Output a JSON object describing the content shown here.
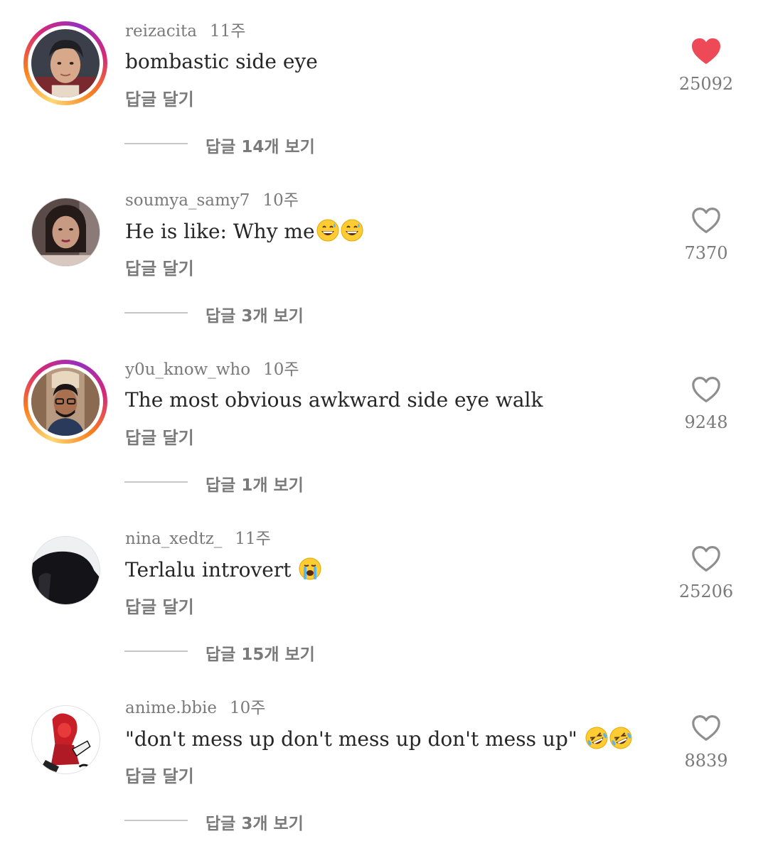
{
  "comments": [
    {
      "username": "reizacita",
      "time": "11주",
      "text": "bombastic side eye",
      "emojis": [],
      "reply_label": "답글 달기",
      "view_replies": "답글 14개 보기",
      "likes": "25092",
      "liked": true,
      "story_ring": true
    },
    {
      "username": "soumya_samy7",
      "time": "10주",
      "text": "He is like: Why me",
      "emojis": [
        "grinning-sweat-emoji",
        "grinning-sweat-emoji"
      ],
      "reply_label": "답글 달기",
      "view_replies": "답글 3개 보기",
      "likes": "7370",
      "liked": false,
      "story_ring": false
    },
    {
      "username": "y0u_know_who",
      "time": "10주",
      "text": "The most obvious awkward side eye walk",
      "emojis": [],
      "reply_label": "답글 달기",
      "view_replies": "답글 1개 보기",
      "likes": "9248",
      "liked": false,
      "story_ring": true
    },
    {
      "username": "nina_xedtz_",
      "time": "11주",
      "text": "Terlalu introvert ",
      "emojis": [
        "loudly-crying-emoji"
      ],
      "reply_label": "답글 달기",
      "view_replies": "답글 15개 보기",
      "likes": "25206",
      "liked": false,
      "story_ring": false
    },
    {
      "username": "anime.bbie",
      "time": "10주",
      "text": "\"don't mess up don't mess up don't mess up\" ",
      "emojis": [
        "rolling-laughing-emoji",
        "rolling-laughing-emoji"
      ],
      "reply_label": "답글 달기",
      "view_replies": "답글 3개 보기",
      "likes": "8839",
      "liked": false,
      "story_ring": false
    }
  ],
  "colors": {
    "liked_heart": "#ed4956",
    "muted_text": "#7a7a7a",
    "primary_text": "#262626"
  }
}
